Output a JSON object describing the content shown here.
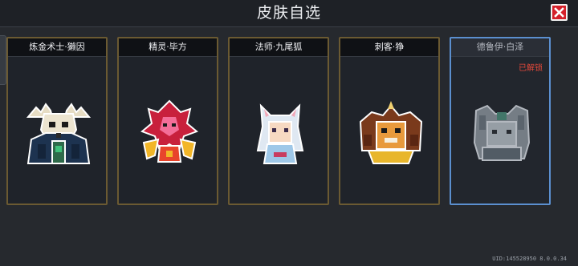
{
  "header": {
    "title": "皮肤自选"
  },
  "close": {
    "label": "关闭"
  },
  "cards": [
    {
      "name": "炼金术士·獭因",
      "portrait": "skull-antler-character-icon",
      "locked": false,
      "badge": ""
    },
    {
      "name": "精灵·毕方",
      "portrait": "fire-bird-character-icon",
      "locked": false,
      "badge": ""
    },
    {
      "name": "法师·九尾狐",
      "portrait": "nine-tail-fox-character-icon",
      "locked": false,
      "badge": ""
    },
    {
      "name": "刺客·狰",
      "portrait": "horned-beast-character-icon",
      "locked": false,
      "badge": ""
    },
    {
      "name": "德鲁伊·白泽",
      "portrait": "white-ze-character-icon",
      "locked": true,
      "badge": "已解锁"
    }
  ],
  "footer": {
    "uid": "UID:145528950 8.0.0.34"
  }
}
